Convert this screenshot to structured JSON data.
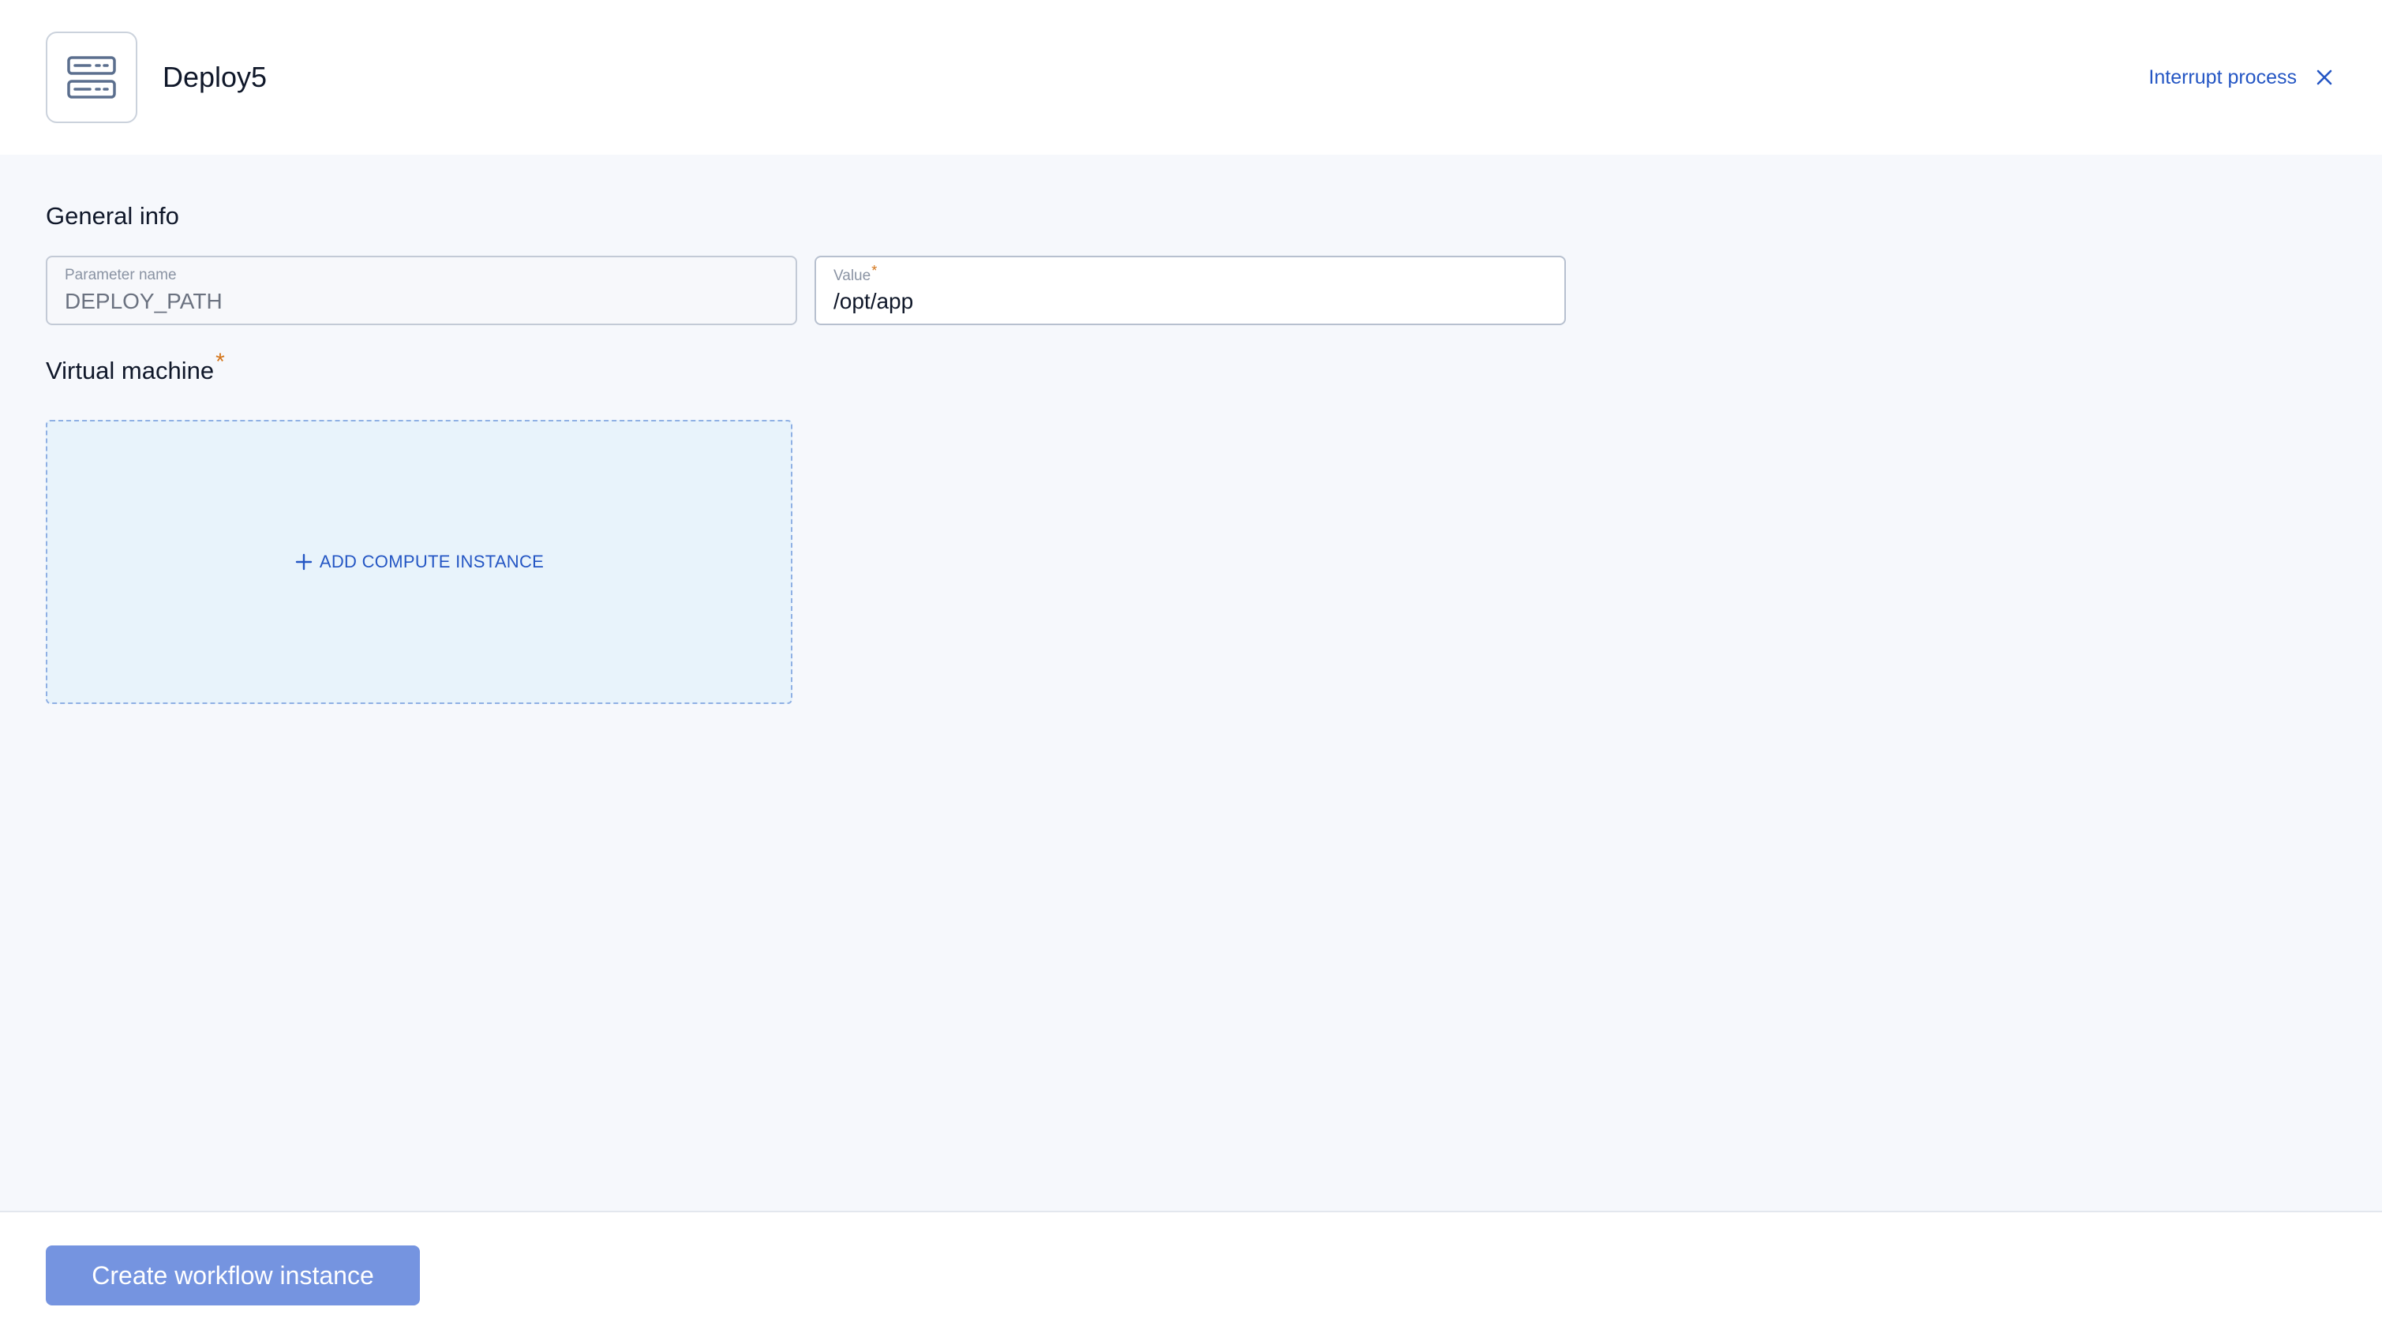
{
  "header": {
    "title": "Deploy5",
    "interrupt_label": "Interrupt process"
  },
  "general_info": {
    "title": "General info",
    "parameter_name": {
      "label": "Parameter name",
      "value": "DEPLOY_PATH"
    },
    "value_field": {
      "label": "Value",
      "required_mark": "*",
      "value": "/opt/app"
    }
  },
  "virtual_machine": {
    "title": "Virtual machine",
    "required_mark": "*",
    "add_label": "ADD COMPUTE INSTANCE"
  },
  "footer": {
    "create_label": "Create workflow instance"
  },
  "colors": {
    "accent": "#2456c4",
    "primary_button": "#7594e0",
    "required": "#d4761b",
    "dropzone_bg": "#e8f3fb",
    "page_bg": "#f6f8fc"
  },
  "icons": {
    "app": "server-stack-icon",
    "interrupt": "close-icon",
    "add": "plus-icon"
  }
}
